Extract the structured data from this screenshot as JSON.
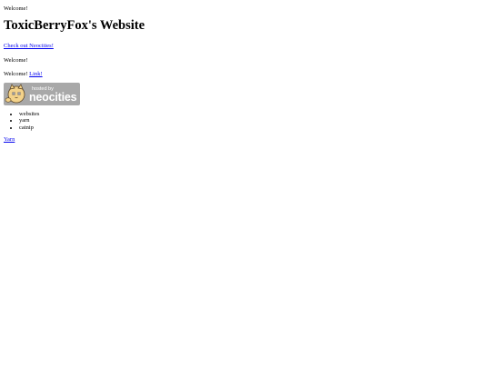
{
  "intro": {
    "welcome": "Welcome!"
  },
  "header": {
    "title": "ToxicBerryFox's Website"
  },
  "links": {
    "neocities": "Check out Neocities!"
  },
  "section2": {
    "welcome": "Welcome!"
  },
  "section3": {
    "welcome_prefix": "Welcome! ",
    "link": "Link!"
  },
  "badge": {
    "hosted_by": "hosted by",
    "brand": "neocities",
    "icon": "neocities-cat-logo"
  },
  "list": {
    "items": [
      "websites",
      "yarn",
      "catnip"
    ]
  },
  "footer": {
    "yarn_link": "Yarn"
  }
}
